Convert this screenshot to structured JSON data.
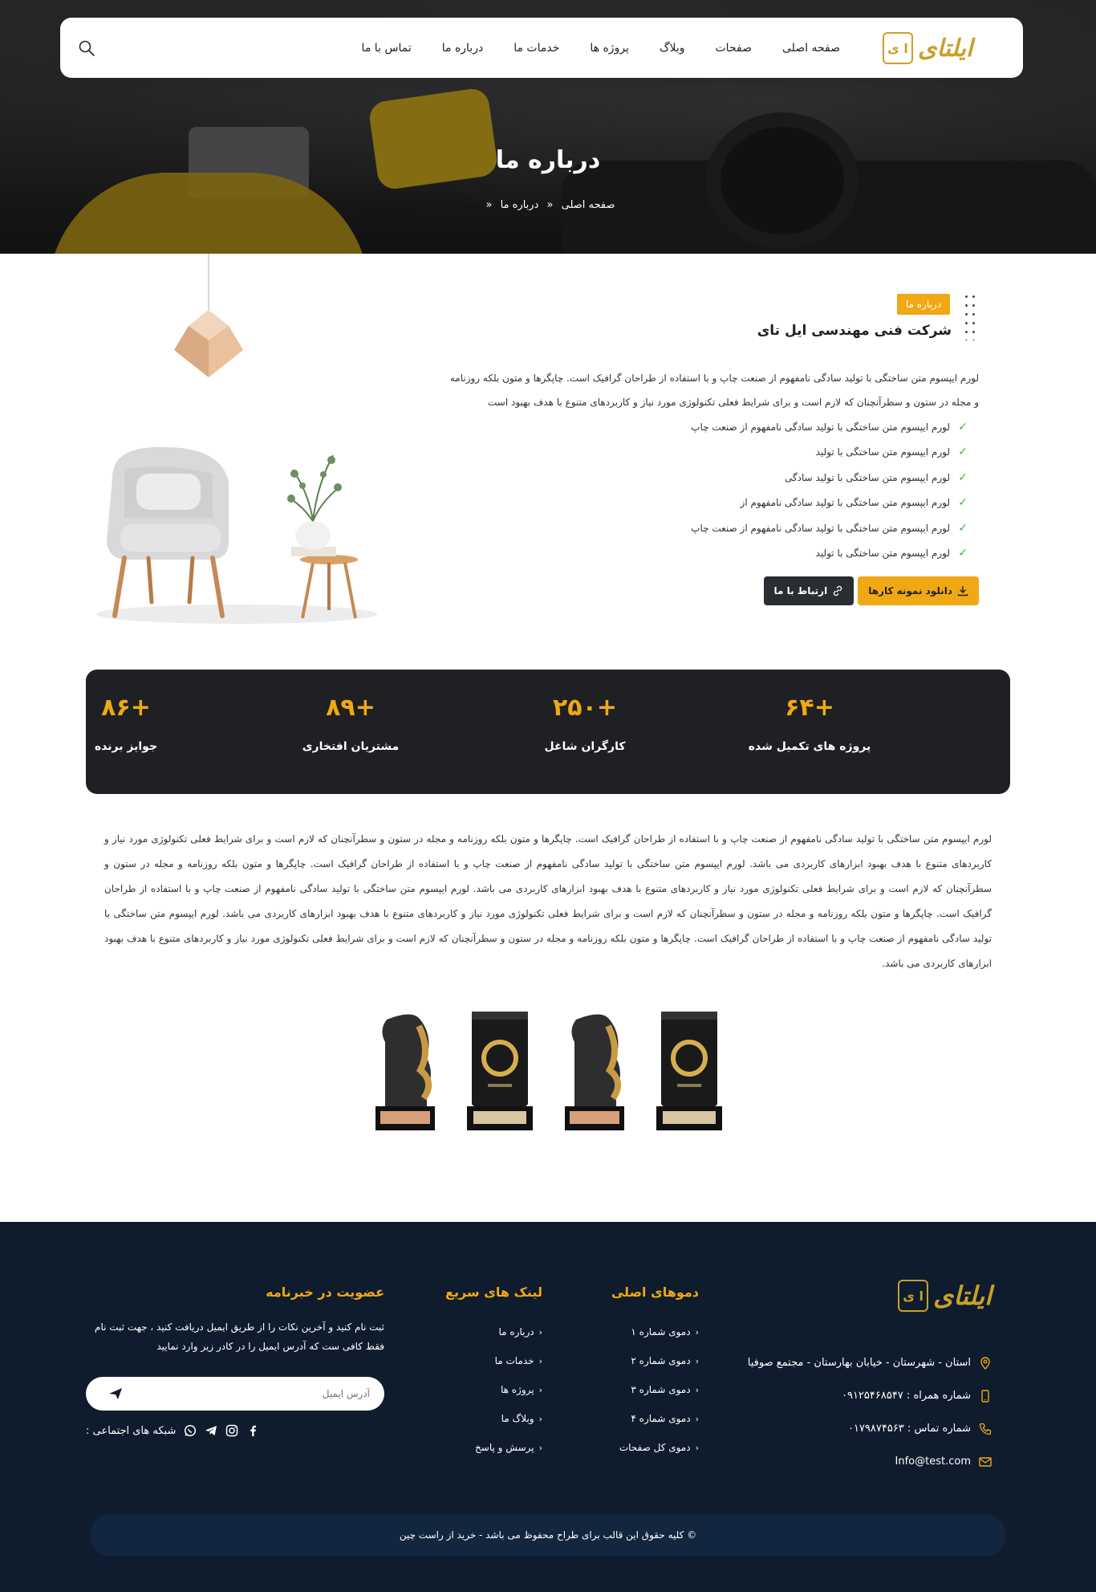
{
  "colors": {
    "accent": "#f0a814",
    "dark": "#1e2023",
    "footer_bg": "#0f1c2e",
    "check": "#3bb43b"
  },
  "brand": {
    "logo_text": "ایلتای",
    "logo_mark": "ا ی"
  },
  "nav": {
    "items": [
      "صفحه اصلی",
      "صفحات",
      "وبلاگ",
      "پروژه ها",
      "خدمات ما",
      "درباره ما",
      "تماس با ما"
    ],
    "search_icon": "search-icon"
  },
  "hero": {
    "title": "درباره ما",
    "breadcrumb": [
      "صفحه اصلی",
      "درباره ما"
    ],
    "separator": "«"
  },
  "about": {
    "tag": "درباره ما",
    "title": "شرکت فنی مهندسی ایل تای",
    "paragraph": "لورم ایپسوم متن ساختگی با تولید سادگی نامفهوم از صنعت چاپ و با استفاده از طراحان گرافیک است. چاپگرها و متون بلکه روزنامه و مجله در ستون و سطرآنچنان که لازم است و برای شرایط فعلی تکنولوژی مورد نیاز و کاربردهای متنوع با هدف بهبود است",
    "checks": [
      "لورم ایپسوم متن ساختگی با تولید سادگی نامفهوم از صنعت چاپ",
      "لورم ایپسوم متن ساختگی با تولید",
      "لورم ایپسوم متن ساختگی با تولید سادگی",
      "لورم ایپسوم متن ساختگی با تولید سادگی نامفهوم از",
      "لورم ایپسوم متن ساختگی با تولید سادگی نامفهوم از صنعت چاپ",
      "لورم ایپسوم متن ساختگی با تولید"
    ],
    "btn_download": "دانلود نمونه کارها",
    "btn_contact": "ارتباط با ما"
  },
  "stats": [
    {
      "num": "+۶۴",
      "label": "پروژه های تکمیل شده"
    },
    {
      "num": "+۲۵۰",
      "label": "کارگران شاغل"
    },
    {
      "num": "+۸۹",
      "label": "مشتریان افتخاری"
    },
    {
      "num": "+۸۶",
      "label": "جوایز برنده"
    }
  ],
  "long_paragraph": "لورم ایپسوم متن ساختگی با تولید سادگی نامفهوم از صنعت چاپ و با استفاده از طراحان گرافیک است. چاپگرها و متون بلکه روزنامه و مجله در ستون و سطرآنچنان که لازم است و برای شرایط فعلی تکنولوژی مورد نیاز و کاربردهای متنوع با هدف بهبود ابزارهای کاربردی می باشد. لورم ایپسوم متن ساختگی با تولید سادگی نامفهوم از صنعت چاپ و با استفاده از طراحان گرافیک است. چاپگرها و متون بلکه روزنامه و مجله در ستون و سطرآنچنان که لازم است و برای شرایط فعلی تکنولوژی مورد نیاز و کاربردهای متنوع با هدف بهبود ابزارهای کاربردی می باشد. لورم ایپسوم متن ساختگی با تولید سادگی نامفهوم از صنعت چاپ و با استفاده از طراحان گرافیک است. چاپگرها و متون بلکه روزنامه و مجله در ستون و سطرآنچنان که لازم است و برای شرایط فعلی تکنولوژی مورد نیاز و کاربردهای متنوع با هدف بهبود ابزارهای کاربردی می باشد. لورم ایپسوم متن ساختگی با تولید سادگی نامفهوم از صنعت چاپ و با استفاده از طراحان گرافیک است. چاپگرها و متون بلکه روزنامه و مجله در ستون و سطرآنچنان که لازم است و برای شرایط فعلی تکنولوژی مورد نیاز و کاربردهای متنوع با هدف بهبود ابزارهای کاربردی می باشد.",
  "footer": {
    "contact": [
      {
        "icon": "location-icon",
        "text": "استان - شهرستان - خیابان بهارستان - مجتمع صوفیا"
      },
      {
        "icon": "mobile-icon",
        "text": "شماره همراه : ۰۹۱۲۵۴۶۸۵۴۷"
      },
      {
        "icon": "phone-icon",
        "text": "شماره تماس : ۰۱۷۹۸۷۴۵۶۳"
      },
      {
        "icon": "mail-icon",
        "text": "Info@test.com"
      }
    ],
    "demos_title": "دموهای اصلی",
    "demos": [
      "دموی شماره ۱",
      "دموی شماره ۲",
      "دموی شماره ۳",
      "دموی شماره ۴",
      "دموی کل صفحات"
    ],
    "links_title": "لینک های سریع",
    "links": [
      "درباره ما",
      "خدمات ما",
      "پروژه ها",
      "وبلاگ ما",
      "پرسش و پاسخ"
    ],
    "news_title": "عضویت در خبرنامه",
    "news_text": "ثبت نام کنید و آخرین نکات را از طریق ایمیل دریافت کنید ، جهت ثبت نام فقط کافی ست که آدرس ایمیل را در کادر زیر وارد نمایید",
    "email_placeholder": "آدرس ایمیل",
    "social_label": "شبکه های اجتماعی :",
    "social_icons": [
      "whatsapp-icon",
      "telegram-icon",
      "instagram-icon",
      "facebook-icon"
    ],
    "copyright": "© کلیه حقوق این قالب برای طراح محفوظ می باشد -  خرید از راست چین"
  }
}
